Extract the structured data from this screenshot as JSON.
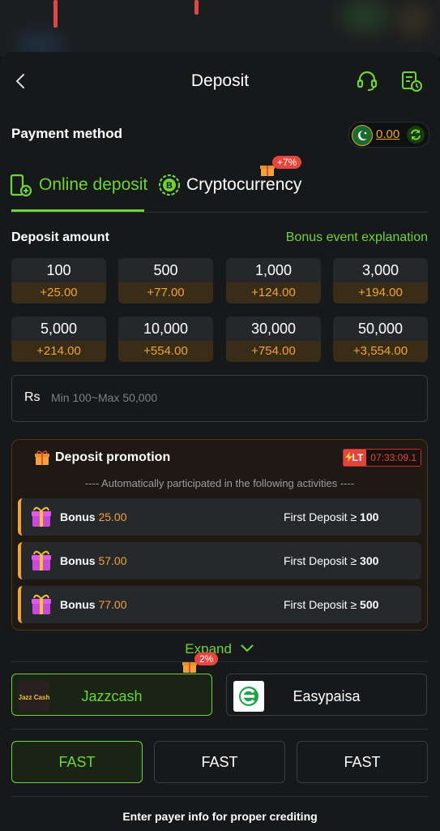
{
  "header": {
    "title": "Deposit"
  },
  "payment_method": {
    "label": "Payment method",
    "balance": "0.00"
  },
  "tabs": [
    {
      "label": "Online deposit",
      "active": true
    },
    {
      "label": "Cryptocurrency",
      "active": false,
      "badge": "+7%"
    }
  ],
  "deposit": {
    "label": "Deposit amount",
    "bonus_link": "Bonus event explanation",
    "amounts": [
      {
        "value": "100",
        "bonus": "+25.00"
      },
      {
        "value": "500",
        "bonus": "+77.00"
      },
      {
        "value": "1,000",
        "bonus": "+124.00"
      },
      {
        "value": "3,000",
        "bonus": "+194.00"
      },
      {
        "value": "5,000",
        "bonus": "+214.00"
      },
      {
        "value": "10,000",
        "bonus": "+554.00"
      },
      {
        "value": "30,000",
        "bonus": "+754.00"
      },
      {
        "value": "50,000",
        "bonus": "+3,554.00"
      }
    ],
    "input": {
      "currency": "Rs",
      "placeholder": "Min 100~Max 50,000"
    }
  },
  "promotion": {
    "title": "Deposit promotion",
    "timer_tag": "LT",
    "timer": "07:33:09.1",
    "note": "---- Automatically participated in the following activities ----",
    "rows": [
      {
        "bonus_label": "Bonus",
        "bonus_value": "25.00",
        "condition": "First Deposit ≥",
        "threshold": "100"
      },
      {
        "bonus_label": "Bonus",
        "bonus_value": "57.00",
        "condition": "First Deposit ≥",
        "threshold": "300"
      },
      {
        "bonus_label": "Bonus",
        "bonus_value": "77.00",
        "condition": "First Deposit ≥",
        "threshold": "500"
      }
    ],
    "expand_label": "Expand"
  },
  "channels": [
    {
      "name": "Jazzcash",
      "selected": true,
      "badge": "2%",
      "logo_text": "Jazz Cash"
    },
    {
      "name": "Easypaisa",
      "selected": false
    }
  ],
  "speeds": [
    {
      "label": "FAST",
      "selected": true
    },
    {
      "label": "FAST",
      "selected": false
    },
    {
      "label": "FAST",
      "selected": false
    }
  ],
  "footer": {
    "note": "Enter payer info for proper crediting"
  },
  "colors": {
    "accent": "#6fd43a",
    "bonus": "#f0a33a",
    "danger": "#e0463c"
  }
}
